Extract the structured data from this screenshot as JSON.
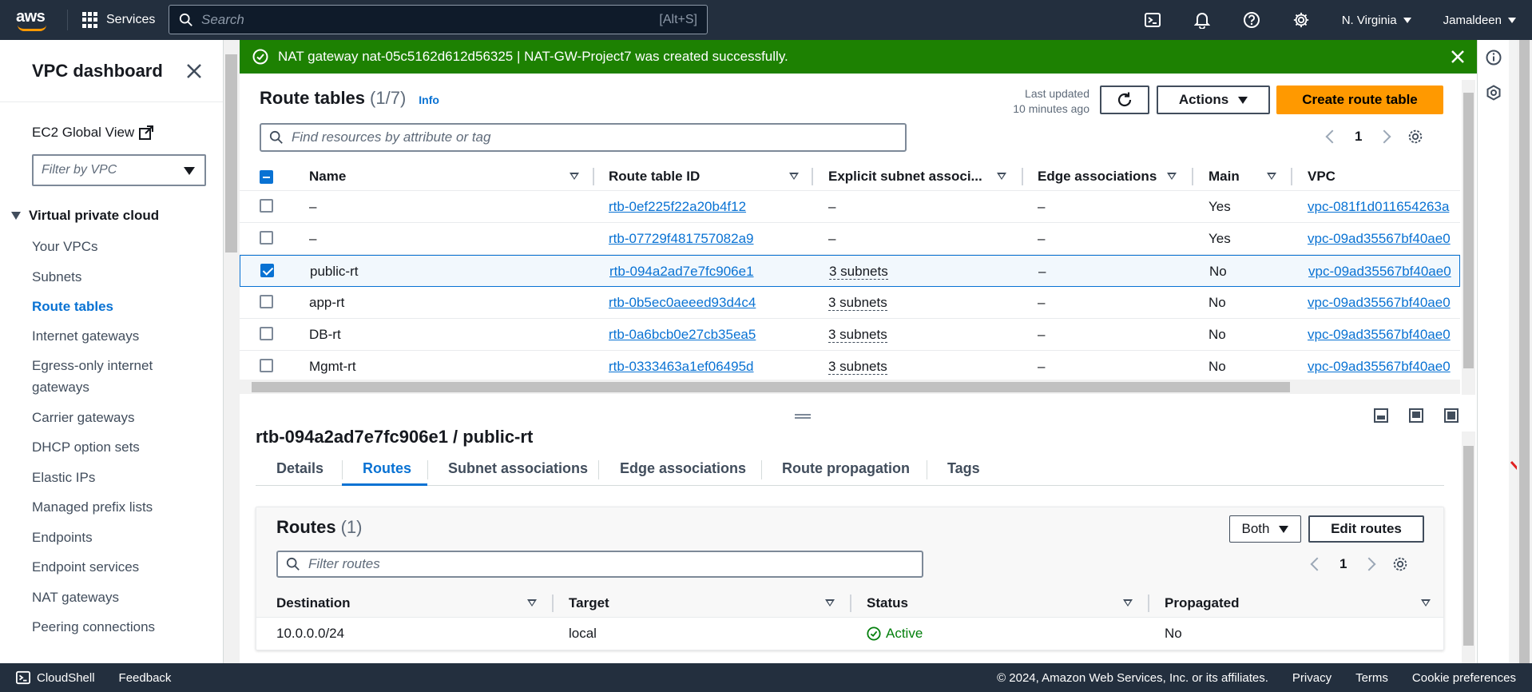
{
  "topnav": {
    "logo_text": "aws",
    "services_label": "Services",
    "search_placeholder": "Search",
    "search_hint": "[Alt+S]",
    "region": "N. Virginia",
    "user": "Jamaldeen"
  },
  "sidebar": {
    "title": "VPC dashboard",
    "ec2_global_view": "EC2 Global View",
    "filter_placeholder": "Filter by VPC",
    "section": "Virtual private cloud",
    "items": [
      {
        "label": "Your VPCs"
      },
      {
        "label": "Subnets"
      },
      {
        "label": "Route tables",
        "active": true
      },
      {
        "label": "Internet gateways"
      },
      {
        "label": "Egress-only internet gateways"
      },
      {
        "label": "Carrier gateways"
      },
      {
        "label": "DHCP option sets"
      },
      {
        "label": "Elastic IPs"
      },
      {
        "label": "Managed prefix lists"
      },
      {
        "label": "Endpoints"
      },
      {
        "label": "Endpoint services"
      },
      {
        "label": "NAT gateways"
      },
      {
        "label": "Peering connections"
      }
    ]
  },
  "flash": {
    "message": "NAT gateway nat-05c5162d612d56325 | NAT-GW-Project7 was created successfully.",
    "color": "#1d8102"
  },
  "route_tables": {
    "title": "Route tables",
    "count": "(1/7)",
    "info": "Info",
    "last_updated_line1": "Last updated",
    "last_updated_line2": "10 minutes ago",
    "actions_label": "Actions",
    "create_label": "Create route table",
    "find_placeholder": "Find resources by attribute or tag",
    "page": "1",
    "columns": [
      "Name",
      "Route table ID",
      "Explicit subnet associ...",
      "Edge associations",
      "Main",
      "VPC"
    ],
    "rows": [
      {
        "name": "–",
        "id": "rtb-0ef225f22a20b4f12",
        "explicit": "–",
        "edge": "–",
        "main": "Yes",
        "vpc": "vpc-081f1d011654263a",
        "selected": false
      },
      {
        "name": "–",
        "id": "rtb-07729f481757082a9",
        "explicit": "–",
        "edge": "–",
        "main": "Yes",
        "vpc": "vpc-09ad35567bf40ae0",
        "selected": false
      },
      {
        "name": "public-rt",
        "id": "rtb-094a2ad7e7fc906e1",
        "explicit": "3 subnets",
        "edge": "–",
        "main": "No",
        "vpc": "vpc-09ad35567bf40ae0",
        "selected": true
      },
      {
        "name": "app-rt",
        "id": "rtb-0b5ec0aeeed93d4c4",
        "explicit": "3 subnets",
        "edge": "–",
        "main": "No",
        "vpc": "vpc-09ad35567bf40ae0",
        "selected": false
      },
      {
        "name": "DB-rt",
        "id": "rtb-0a6bcb0e27cb35ea5",
        "explicit": "3 subnets",
        "edge": "–",
        "main": "No",
        "vpc": "vpc-09ad35567bf40ae0",
        "selected": false
      },
      {
        "name": "Mgmt-rt",
        "id": "rtb-0333463a1ef06495d",
        "explicit": "3 subnets",
        "edge": "–",
        "main": "No",
        "vpc": "vpc-09ad35567bf40ae0",
        "selected": false
      }
    ]
  },
  "detail": {
    "title": "rtb-094a2ad7e7fc906e1 / public-rt",
    "tabs": [
      "Details",
      "Routes",
      "Subnet associations",
      "Edge associations",
      "Route propagation",
      "Tags"
    ],
    "active_tab": "Routes"
  },
  "routes": {
    "title": "Routes",
    "count": "(1)",
    "both_label": "Both",
    "edit_label": "Edit routes",
    "filter_placeholder": "Filter routes",
    "page": "1",
    "columns": [
      "Destination",
      "Target",
      "Status",
      "Propagated"
    ],
    "rows": [
      {
        "destination": "10.0.0.0/24",
        "target": "local",
        "status": "Active",
        "propagated": "No"
      }
    ]
  },
  "footer": {
    "cloudshell": "CloudShell",
    "feedback": "Feedback",
    "copyright": "© 2024, Amazon Web Services, Inc. or its affiliates.",
    "privacy": "Privacy",
    "terms": "Terms",
    "cookies": "Cookie preferences"
  },
  "colors": {
    "accent": "#0972d3",
    "nav": "#232f3e",
    "primary_button": "#ff9900",
    "success": "#037f0c",
    "annotation_arrow": "#e02020"
  }
}
